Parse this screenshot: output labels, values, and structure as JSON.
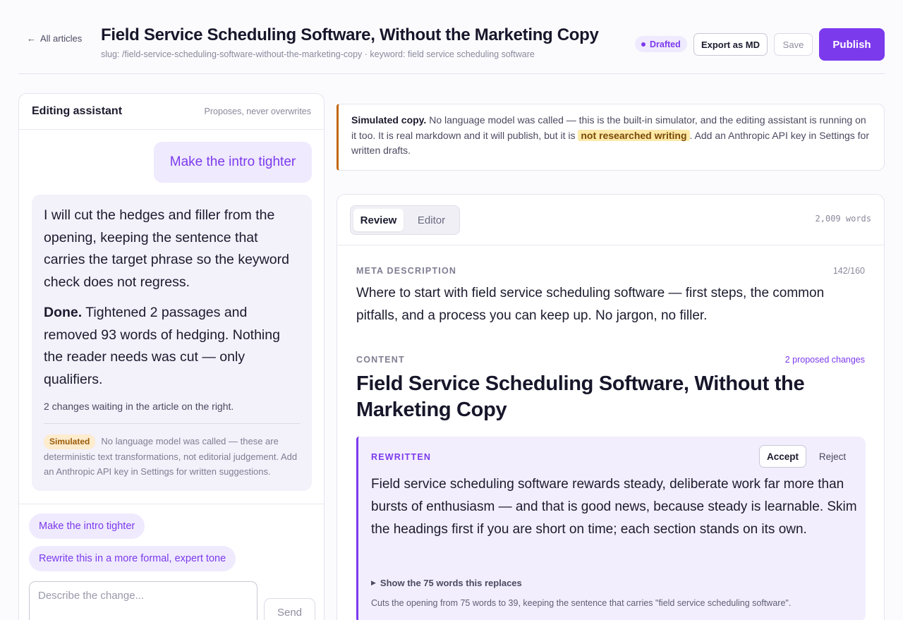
{
  "header": {
    "back_label": "All articles",
    "title": "Field Service Scheduling Software, Without the Marketing Copy",
    "slug_line": "slug: /field-service-scheduling-software-without-the-marketing-copy · keyword: field service scheduling software",
    "status": "Drafted",
    "export_label": "Export as MD",
    "save_label": "Save",
    "publish_label": "Publish"
  },
  "assistant": {
    "title": "Editing assistant",
    "subtitle": "Proposes, never overwrites",
    "user_message": "Make the intro tighter",
    "reply_plan": "I will cut the hedges and filler from the opening, keeping the sentence that carries the target phrase so the keyword check does not regress.",
    "reply_done_label": "Done.",
    "reply_done_text": " Tightened 2 passages and removed 93 words of hedging. Nothing the reader needs was cut — only qualifiers.",
    "waiting_text": "2 changes waiting in the article on the right.",
    "sim_chip": "Simulated",
    "sim_note": "No language model was called — these are deterministic text transformations, not editorial judgement. Add an Anthropic API key in Settings for written suggestions.",
    "suggestions": [
      "Make the intro tighter",
      "Rewrite this in a more formal, expert tone"
    ],
    "input_placeholder": "Describe the change...",
    "send_label": "Send"
  },
  "notice": {
    "strong": "Simulated copy.",
    "text_before": " No language model was called — this is the built-in simulator, and the editing assistant is running on it too. It is real markdown and it will publish, but it is ",
    "highlight": "not researched writing",
    "text_after": ". Add an Anthropic API key in Settings for written drafts."
  },
  "article": {
    "tabs": [
      "Review",
      "Editor"
    ],
    "active_tab": "Review",
    "word_count": "2,009 words",
    "meta_label": "META DESCRIPTION",
    "meta_count": "142/160",
    "meta_text": "Where to start with field service scheduling software — first steps, the common pitfalls, and a process you can keep up. No jargon, no filler.",
    "content_label": "CONTENT",
    "proposed_changes": "2 proposed changes",
    "heading": "Field Service Scheduling Software, Without the Marketing Copy",
    "rewrite": {
      "label": "REWRITTEN",
      "accept_label": "Accept",
      "reject_label": "Reject",
      "text": "Field service scheduling software rewards steady, deliberate work far more than bursts of enthusiasm — and that is good news, because steady is learnable. Skim the headings first if you are short on time; each section stands on its own.",
      "show_replaced": "Show the 75 words this replaces",
      "note": "Cuts the opening from 75 words to 39, keeping the sentence that carries \"field service scheduling software\"."
    }
  },
  "colors": {
    "accent": "#7c3aed",
    "accent_soft": "#efeafd",
    "warning_border": "#c2670e",
    "highlight": "#fde9a8"
  },
  "icons": {
    "back": "arrow-left-icon",
    "status": "dot-icon",
    "disclosure": "triangle-right-icon"
  }
}
